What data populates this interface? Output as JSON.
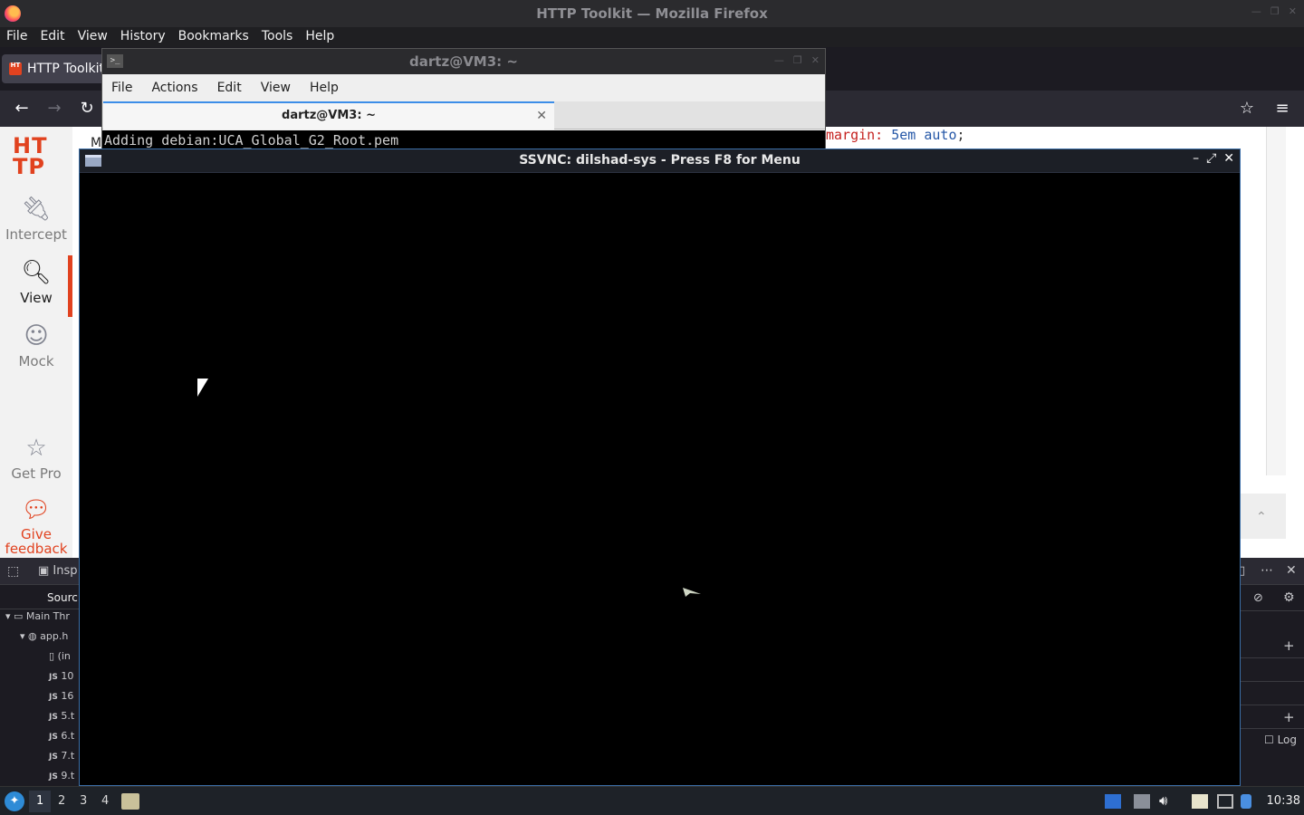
{
  "firefox": {
    "window_title": "HTTP Toolkit — Mozilla Firefox",
    "menu": [
      "File",
      "Edit",
      "View",
      "History",
      "Bookmarks",
      "Tools",
      "Help"
    ],
    "tab_title": "HTTP Toolkit",
    "tab_favicon_text": "HT"
  },
  "toolkit": {
    "logo_line1": "HT",
    "logo_line2": "TP",
    "nav": {
      "intercept": "Intercept",
      "view": "View",
      "mock": "Mock",
      "get_pro": "Get Pro",
      "feedback_line1": "Give",
      "feedback_line2": "feedback"
    },
    "code_prop": "margin:",
    "code_val1": "5em",
    "code_val2": "auto",
    "code_semicolon": ";",
    "stray_char": "M"
  },
  "devtools": {
    "inspector_label": "Insp",
    "sources_label": "Sourc",
    "tree": [
      {
        "icon": "▾",
        "label": "Main Thr"
      },
      {
        "icon": "▾",
        "label": "app.h"
      },
      {
        "icon": "",
        "label": "(in"
      },
      {
        "icon": "JS",
        "label": "10"
      },
      {
        "icon": "JS",
        "label": "16"
      },
      {
        "icon": "JS",
        "label": "5.t"
      },
      {
        "icon": "JS",
        "label": "6.t"
      },
      {
        "icon": "JS",
        "label": "7.t"
      },
      {
        "icon": "JS",
        "label": "9.t"
      }
    ],
    "log_label": "Log"
  },
  "terminal": {
    "window_title": "dartz@VM3: ~",
    "menu": [
      "File",
      "Actions",
      "Edit",
      "View",
      "Help"
    ],
    "tab_title": "dartz@VM3: ~",
    "output_line": "Adding debian:UCA_Global_G2_Root.pem"
  },
  "vnc": {
    "window_title": "SSVNC: dilshad-sys - Press F8 for Menu"
  },
  "taskbar": {
    "workspaces": [
      "1",
      "2",
      "3",
      "4"
    ],
    "active_workspace": "1",
    "clock": "10:38"
  },
  "colors": {
    "accent": "#e1421f",
    "vnc_border": "#3c6fa8",
    "terminal_tab_highlight": "#3d8ee8"
  }
}
